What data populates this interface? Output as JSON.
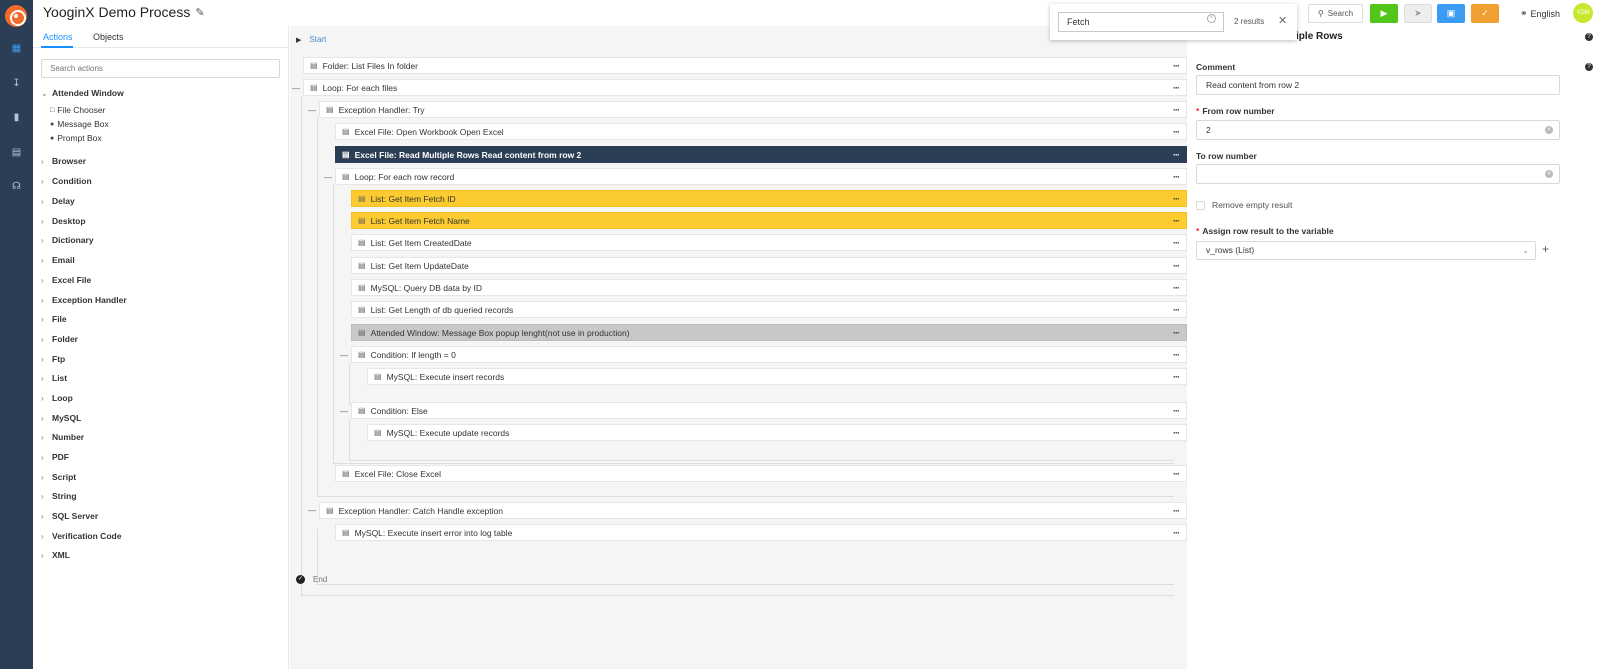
{
  "header": {
    "title": "YooginX Demo Process",
    "search_value": "Fetch",
    "results": "2 results",
    "search_label": "Search",
    "language": "English",
    "avatar": "YDM"
  },
  "sidebar": {
    "tabs": [
      "Actions",
      "Objects"
    ],
    "search_placeholder": "Search actions",
    "expanded": {
      "label": "Attended Window",
      "items": [
        "File Chooser",
        "Message Box",
        "Prompt Box"
      ]
    },
    "categories": [
      "Browser",
      "Condition",
      "Delay",
      "Desktop",
      "Dictionary",
      "Email",
      "Excel File",
      "Exception Handler",
      "File",
      "Folder",
      "Ftp",
      "List",
      "Loop",
      "MySQL",
      "Number",
      "PDF",
      "Script",
      "String",
      "SQL Server",
      "Verification Code",
      "XML"
    ]
  },
  "canvas": {
    "start": "Start",
    "end": "End",
    "rows": [
      "Folder: List Files In folder",
      "Loop: For each files",
      "Exception Handler: Try",
      "Excel File: Open Workbook Open Excel",
      "Excel File: Read Multiple Rows Read content from row 2",
      "Loop: For each row record",
      "List: Get Item Fetch ID",
      "List: Get Item Fetch Name",
      "List: Get Item CreatedDate",
      "List: Get Item UpdateDate",
      "MySQL: Query DB data by ID",
      "List: Get Length of db queried records",
      "Attended Window: Message Box popup lenght(not use in production)",
      "Condition: If length = 0",
      "MySQL: Execute insert records",
      "Condition: Else",
      "MySQL: Execute update records",
      "Excel File: Close Excel",
      "Exception Handler: Catch Handle exception",
      "MySQL: Execute insert error into log table"
    ]
  },
  "panel": {
    "title": "Excel File: Read Multiple Rows",
    "comment_label": "Comment",
    "comment_value": "Read content from row 2",
    "from_label": "From row number",
    "from_value": "2",
    "to_label": "To row number",
    "to_value": "",
    "remove_empty": "Remove empty result",
    "assign_label": "Assign row result to the variable",
    "assign_value": "v_rows (List)"
  },
  "colors": {
    "rail": "#2c3e55",
    "selected_row": "#2c3e55",
    "highlight_row": "#fccb2f",
    "disabled_row": "#c8c8c8",
    "accent": "#1890ff"
  }
}
